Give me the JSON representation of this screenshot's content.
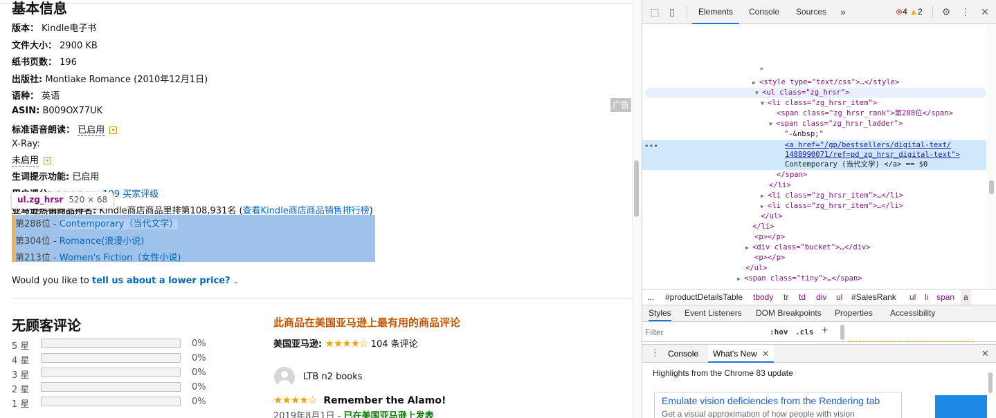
{
  "product": {
    "section_title": "基本信息",
    "version_label": "版本：",
    "version_value": "Kindle电子书",
    "filesize_label": "文件大小：",
    "filesize_value": "2900 KB",
    "pages_label": "纸书页数：",
    "pages_value": "196",
    "publisher_label": "出版社:",
    "publisher_value": "Montlake Romance (2010年12月1日)",
    "language_label": "语种：",
    "language_value": "英语",
    "asin_label": "ASIN:",
    "asin_value": "B009OX77UK",
    "tts_label": "标准语音朗读：",
    "tts_value": "已启用",
    "xray_label": "X-Ray:",
    "xray_value": "未启用",
    "wordwise_label": "生词提示功能:",
    "wordwise_value": "已启用",
    "reviews_label": "用户评分:",
    "reviews_link": "109 买家评级",
    "rank_label": "亚马逊热销商品排名:",
    "rank_text": "Kindle商店商品里排第108,931名 (",
    "rank_link": "查看Kindle商店商品销售排行榜",
    "rank_close": ")",
    "ranks": [
      {
        "rank": "第288位 - ",
        "category": "Contemporary（当代文学）"
      },
      {
        "rank": "第304位 - ",
        "category": "Romance(浪漫小说)"
      },
      {
        "rank": "第213位 - ",
        "category": "Women's Fiction（女性小说)"
      }
    ],
    "lower_price_prefix": "Would you like to ",
    "lower_price_link": "tell us about a lower price?",
    "ad_label": "广告"
  },
  "inspector_tooltip": {
    "selector": "ul.zg_hrsr",
    "size": "520 × 68"
  },
  "reviews": {
    "title": "无顾客评论",
    "rows": [
      {
        "label": "5 星",
        "pct": "0%",
        "fill": 0
      },
      {
        "label": "4 星",
        "pct": "0%",
        "fill": 0
      },
      {
        "label": "3 星",
        "pct": "0%",
        "fill": 0
      },
      {
        "label": "2 星",
        "pct": "0%",
        "fill": 0
      },
      {
        "label": "1 星",
        "pct": "0%",
        "fill": 0
      }
    ],
    "us_title": "此商品在美国亚马逊上最有用的商品评论",
    "us_label": "美国亚马逊:",
    "us_count": "104 条评论",
    "reviewer": "LTB n2 books",
    "review_title": "Remember the Alamo!",
    "review_date": "2019年8月1日 - ",
    "review_source": "已在美国亚马逊上发表"
  },
  "devtools": {
    "tabs": [
      "Elements",
      "Console",
      "Sources"
    ],
    "more_tabs": "»",
    "errors": "4",
    "warnings": "2",
    "dom_lines": [
      {
        "text": "\""
      },
      {
        "text": "<style type=\"text/css\">…</style>"
      },
      {
        "text": "<ul class=\"zg_hrsr\">"
      },
      {
        "text": "<li class=\"zg_hrsr_item\">"
      },
      {
        "text": "<span class=\"zg_hrsr_rank\">第288位</span>"
      },
      {
        "text": "<span class=\"zg_hrsr_ladder\">"
      },
      {
        "text": "\"-&nbsp;\""
      },
      {
        "text": "<a href=\"/gp/bestsellers/digital-text/"
      },
      {
        "text": "1488990071/ref=pd_zg_hrsr_digital-text\">"
      },
      {
        "text": "Contemporary (当代文学) </a> == $0"
      },
      {
        "text": "</span>"
      },
      {
        "text": "</li>"
      },
      {
        "text": "<li class=\"zg_hrsr_item\">…</li>"
      },
      {
        "text": "<li class=\"zg_hrsr_item\">…</li>"
      },
      {
        "text": "</ul>"
      },
      {
        "text": "</li>"
      },
      {
        "text": "<p></p>"
      },
      {
        "text": "<div class=\"bucket\">…</div>"
      },
      {
        "text": "<p></p>"
      },
      {
        "text": "</ul>"
      },
      {
        "text": "<span class=\"tiny\">…</span>"
      }
    ],
    "breadcrumbs": [
      "...",
      "#productDetailsTable",
      "tbody",
      "tr",
      "td",
      "div",
      "ul",
      "#SalesRank",
      "ul",
      "li",
      "span",
      "a"
    ],
    "subtabs": [
      "Styles",
      "Event Listeners",
      "DOM Breakpoints",
      "Properties",
      "Accessibility"
    ],
    "filter_placeholder": "Filter",
    "hov": ":hov",
    "cls": ".cls",
    "drawer_tabs": [
      "Console",
      "What's New"
    ],
    "whatsnew_heading": "Highlights from the Chrome 83 update",
    "card_title": "Emulate vision deficiencies from the Rendering tab",
    "card_desc": "Get a visual approximation of how people with vision"
  }
}
